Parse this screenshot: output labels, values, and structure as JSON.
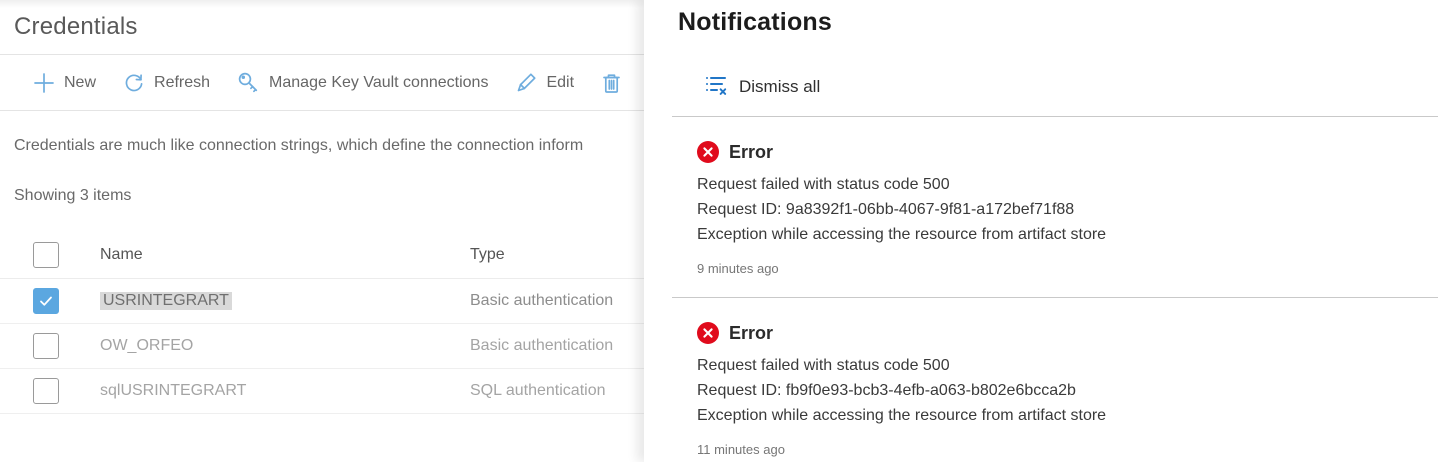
{
  "credentials_panel": {
    "title": "Credentials",
    "toolbar": {
      "new_label": "New",
      "refresh_label": "Refresh",
      "manage_kv_label": "Manage Key Vault connections",
      "edit_label": "Edit"
    },
    "description": "Credentials are much like connection strings, which define the connection inform",
    "showing_text": "Showing 3 items",
    "table": {
      "columns": {
        "name": "Name",
        "type": "Type"
      },
      "rows": [
        {
          "name": "USRINTEGRART",
          "type": "Basic authentication"
        },
        {
          "name": "OW_ORFEO",
          "type": "Basic authentication"
        },
        {
          "name": "sqlUSRINTEGRART",
          "type": "SQL authentication"
        }
      ]
    }
  },
  "notifications_panel": {
    "title": "Notifications",
    "dismiss_all_label": "Dismiss all",
    "items": [
      {
        "severity": "Error",
        "lines": [
          "Request failed with status code 500",
          "Request ID: 9a8392f1-06bb-4067-9f81-a172bef71f88",
          "Exception while accessing the resource from artifact store"
        ],
        "time": "9 minutes ago"
      },
      {
        "severity": "Error",
        "lines": [
          "Request failed with status code 500",
          "Request ID: fb9f0e93-bcb3-4efb-a063-b802e6bcca2b",
          "Exception while accessing the resource from artifact store"
        ],
        "time": "11 minutes ago"
      }
    ]
  },
  "colors": {
    "toolbar_icon_blue": "#6fadde",
    "action_blue": "#2176c7",
    "error_red": "#e00b1c",
    "checkbox_checked_blue": "#5ba7e0",
    "name_highlight_gray": "#d9d9d9"
  }
}
